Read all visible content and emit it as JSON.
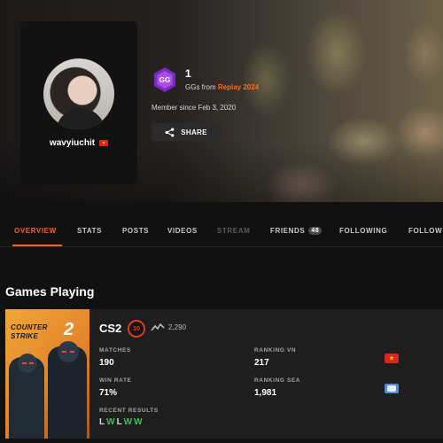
{
  "profile": {
    "username": "wavyiuchit",
    "gg": {
      "badge_label": "GG",
      "count": "1",
      "from_text": "GGs from ",
      "from_source": "Replay 2024"
    },
    "member_since": "Member since Feb 3, 2020",
    "share_label": "SHARE"
  },
  "tabs": [
    {
      "label": "OVERVIEW",
      "state": "active"
    },
    {
      "label": "STATS",
      "state": "normal"
    },
    {
      "label": "POSTS",
      "state": "normal"
    },
    {
      "label": "VIDEOS",
      "state": "normal"
    },
    {
      "label": "STREAM",
      "state": "disabled"
    },
    {
      "label": "FRIENDS",
      "state": "normal",
      "count": "48"
    },
    {
      "label": "FOLLOWING",
      "state": "normal"
    },
    {
      "label": "FOLLOW",
      "state": "normal"
    }
  ],
  "games_section": {
    "title": "Games Playing",
    "games": [
      {
        "art": {
          "line1": "COUNTER",
          "line2": "STRIKE",
          "number": "2"
        },
        "name": "CS2",
        "level": "10",
        "elo": "2,290",
        "stats": {
          "matches_label": "MATCHES",
          "matches": "190",
          "win_rate_label": "WIN RATE",
          "win_rate": "71%",
          "ranking_vn_label": "RANKING VN",
          "ranking_vn": "217",
          "ranking_sea_label": "RANKING SEA",
          "ranking_sea": "1,981"
        },
        "recent_results_label": "RECENT RESULTS",
        "recent_results": [
          "L",
          "W",
          "L",
          "W",
          "W"
        ]
      }
    ]
  },
  "colors": {
    "accent": "#ff5b24",
    "win": "#39c256",
    "level_ring": "#e23a1c",
    "gg_badge": "#7a2bc4"
  },
  "icons": {
    "share": "share-icon",
    "elo": "elo-trend-icon",
    "flag_vn": "vietnam-flag-icon",
    "flag_sea": "sea-region-flag-icon"
  }
}
